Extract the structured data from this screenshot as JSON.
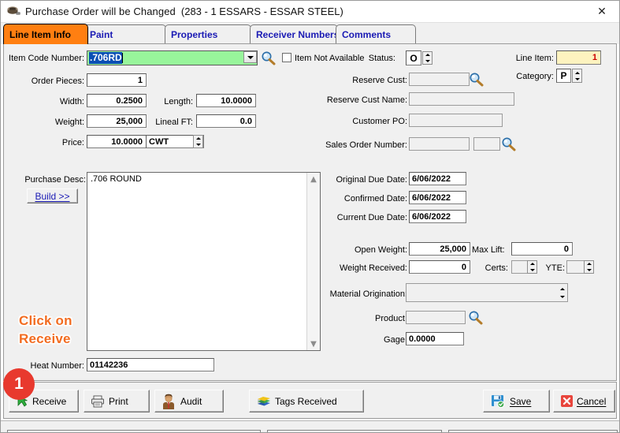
{
  "window": {
    "title": "Purchase Order will be Changed",
    "subtitle": "(283 - 1  ESSARS -  ESSAR STEEL)",
    "close_label": "✕",
    "icon": "scanner-icon"
  },
  "tabs": [
    {
      "label": "Line Item Info",
      "active": true
    },
    {
      "label": "Paint",
      "active": false
    },
    {
      "label": "Properties",
      "active": false
    },
    {
      "label": "Receiver Numbers",
      "active": false
    },
    {
      "label": "Comments",
      "active": false
    }
  ],
  "left": {
    "item_code_label": "Item Code Number:",
    "item_code_value": ".706RD",
    "item_not_available_label": "Item Not Available",
    "item_not_available_checked": false,
    "order_pieces_label": "Order Pieces:",
    "order_pieces_value": "1",
    "width_label": "Width:",
    "width_value": "0.2500",
    "length_label": "Length:",
    "length_value": "10.0000",
    "weight_label": "Weight:",
    "weight_value": "25,000",
    "lineal_ft_label": "Lineal FT:",
    "lineal_ft_value": "0.0",
    "price_label": "Price:",
    "price_value": "10.0000",
    "price_uom_value": "CWT",
    "purchase_desc_label": "Purchase Desc:",
    "purchase_desc_value": ".706 ROUND",
    "build_label": "Build >>",
    "heat_number_label": "Heat Number:",
    "heat_number_value": "01142236"
  },
  "right": {
    "status_label": "Status:",
    "status_value": "O",
    "line_item_label": "Line Item:",
    "line_item_value": "1",
    "category_label": "Category:",
    "category_value": "P",
    "reserve_cust_label": "Reserve Cust:",
    "reserve_cust_value": "",
    "reserve_cust_name_label": "Reserve Cust Name:",
    "reserve_cust_name_value": "",
    "customer_po_label": "Customer PO:",
    "customer_po_value": "",
    "sales_order_number_label": "Sales Order Number:",
    "sales_order_number_value": "",
    "sales_order_number_value2": "",
    "original_due_date_label": "Original Due Date:",
    "original_due_date_value": "6/06/2022",
    "confirmed_date_label": "Confirmed Date:",
    "confirmed_date_value": "6/06/2022",
    "current_due_date_label": "Current Due Date:",
    "current_due_date_value": "6/06/2022",
    "open_weight_label": "Open Weight:",
    "open_weight_value": "25,000",
    "weight_received_label": "Weight Received:",
    "weight_received_value": "0",
    "max_lift_label": "Max Lift:",
    "max_lift_value": "0",
    "certs_label": "Certs:",
    "certs_value": "",
    "yte_label": "YTE:",
    "yte_value": "",
    "material_origination_label": "Material Origination:",
    "material_origination_value": "",
    "product_label": "Product:",
    "product_value": "",
    "gage_label": "Gage:",
    "gage_value": "0.0000"
  },
  "buttons": {
    "receive": "Receive",
    "print": "Print",
    "audit": "Audit",
    "tags_received": "Tags Received",
    "save": "Save",
    "cancel": "Cancel"
  },
  "annotation": {
    "line1": "Click on",
    "line2": "Receive",
    "badge": "1",
    "color": "#f26c21",
    "badge_color": "#e8392e"
  }
}
